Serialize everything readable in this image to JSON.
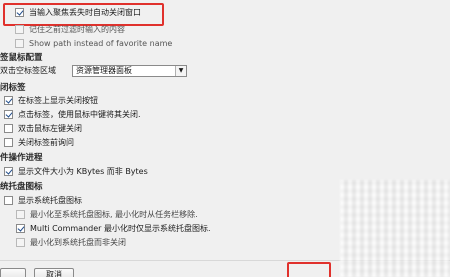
{
  "top_section": {
    "items": [
      {
        "label": "当输入聚焦丢失时自动关闭窗口",
        "checked": true,
        "disabled": false
      },
      {
        "label": "记住之前过滤时输入的内容",
        "checked": false,
        "disabled": true
      },
      {
        "label": "Show path instead of favorite name",
        "checked": false,
        "disabled": true
      }
    ]
  },
  "tab_mouse": {
    "heading": "签鼠标配置",
    "double_click_label": "双击空标签区域",
    "double_click_value": "资源管理器面板"
  },
  "close_tab": {
    "heading": "闭标签",
    "items": [
      {
        "label": "在标签上显示关闭按钮",
        "checked": true
      },
      {
        "label": "点击标签，使用鼠标中键将其关闭.",
        "checked": true
      },
      {
        "label": "双击鼠标左键关闭",
        "checked": false
      },
      {
        "label": "关闭标签前询问",
        "checked": false
      }
    ]
  },
  "file_ops": {
    "heading": "件操作进程",
    "items": [
      {
        "label": "显示文件大小为 KBytes 而非 Bytes",
        "checked": true
      }
    ]
  },
  "tray": {
    "heading": "统托盘图标",
    "items": [
      {
        "label": "显示系统托盘图标",
        "checked": false,
        "disabled": false
      },
      {
        "label": "最小化至系统托盘图标, 最小化时从任务栏移除.",
        "checked": false,
        "disabled": true
      },
      {
        "label": "Multi Commander 最小化时仅显示系统托盘图标.",
        "checked": true,
        "disabled": false
      },
      {
        "label": "最小化到系统托盘而非关闭",
        "checked": false,
        "disabled": true
      }
    ]
  },
  "footer": {
    "cancel_label": "取消"
  },
  "colors": {
    "highlight": "#e0312c",
    "check": "#1e4b8a"
  }
}
